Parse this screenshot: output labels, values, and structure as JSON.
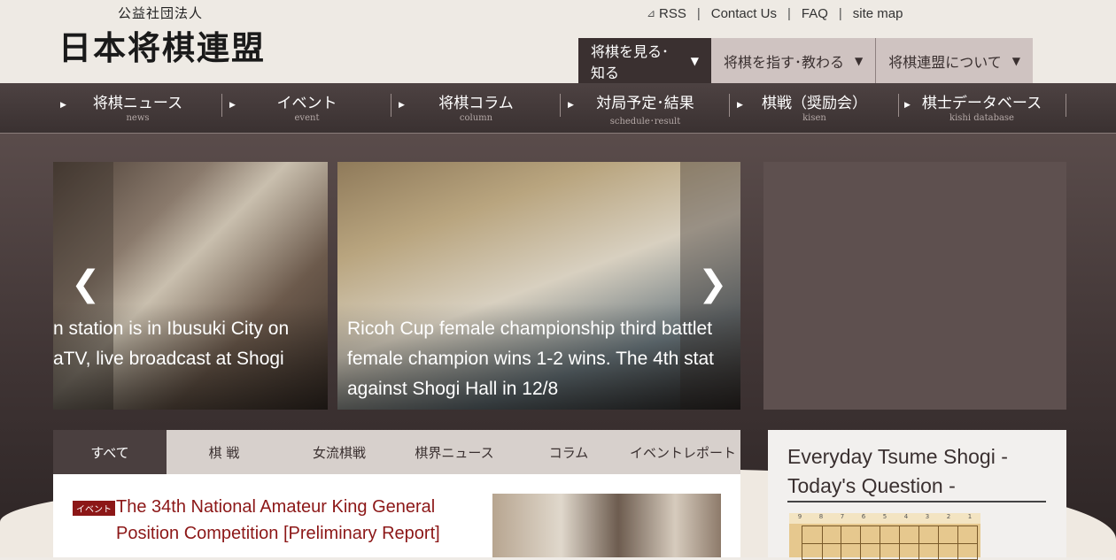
{
  "header": {
    "org_small": "公益社団法人",
    "org_big": "日本将棋連盟",
    "links": [
      "RSS",
      "Contact Us",
      "FAQ",
      "site map"
    ],
    "link_sep": "|"
  },
  "mainnav": [
    {
      "label": "将棋を見る･知る"
    },
    {
      "label": "将棋を指す･教わる"
    },
    {
      "label": "将棋連盟について"
    }
  ],
  "caret": "▼",
  "subnav": [
    {
      "jp": "将棋ニュース",
      "en": "news"
    },
    {
      "jp": "イベント",
      "en": "event"
    },
    {
      "jp": "将棋コラム",
      "en": "column"
    },
    {
      "jp": "対局予定･結果",
      "en": "schedule･result"
    },
    {
      "jp": "棋戦（奨励会）",
      "en": "kisen"
    },
    {
      "jp": "棋士データベース",
      "en": "kishi database"
    }
  ],
  "slider": {
    "prev": "❮",
    "next": "❯",
    "left_caption": "n station is in Ibusuki City on\naTV, live broadcast at Shogi",
    "mid_caption": "Ricoh Cup female championship third battlet\nfemale champion wins 1-2 wins. The 4th stat\nagainst Shogi Hall in 12/8"
  },
  "tabs": [
    "すべて",
    "棋 戦",
    "女流棋戦",
    "棋界ニュース",
    "コラム",
    "イベントレポート"
  ],
  "news": {
    "badge": "イベント",
    "title": "The 34th National Amateur King General Position Competition [Preliminary Report]"
  },
  "tsume": {
    "title": "Everyday Tsume Shogi - Today's Question -",
    "board_nums": [
      "9",
      "8",
      "7",
      "6",
      "5",
      "4",
      "3",
      "2",
      "1"
    ]
  }
}
